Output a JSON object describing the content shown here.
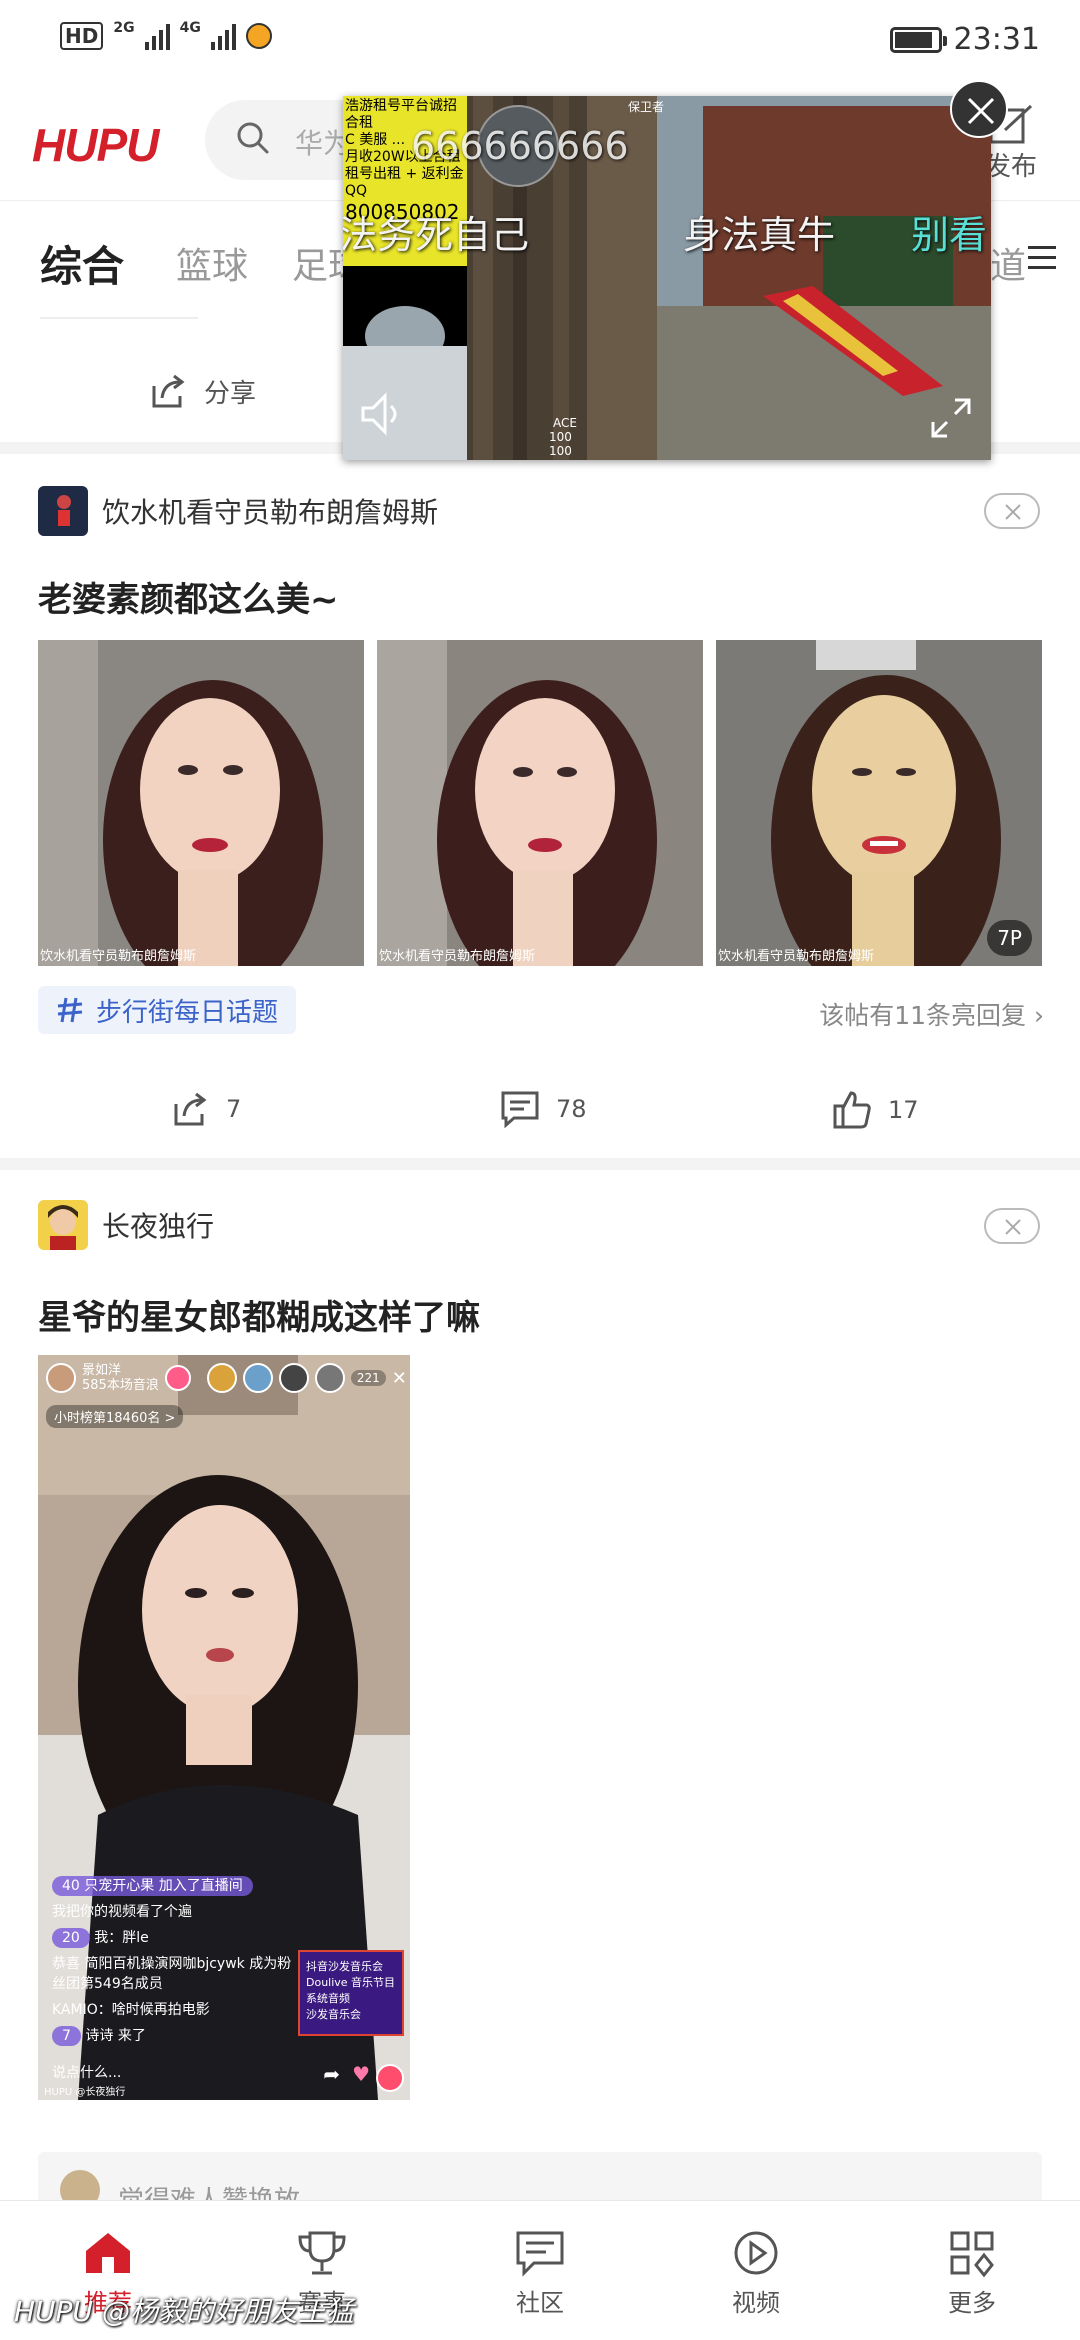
{
  "status_bar": {
    "left_badge": "HD",
    "left_badge_sub": "2",
    "net1": "2G",
    "net2": "4G",
    "time": "23:31"
  },
  "header": {
    "logo": "HUPU",
    "search_placeholder": "华为",
    "post_label": "发布"
  },
  "tabs": {
    "items": [
      "综合",
      "篮球",
      "足球"
    ],
    "right_partial": "道"
  },
  "prev_post": {
    "share_label": "分享"
  },
  "floating_video": {
    "ad_lines": [
      "浩游租号平台诚招合租",
      "C 美服 ...",
      "月收20W以上合租",
      "租号出租 + 返利金QQ",
      "800850802"
    ],
    "overlay_big": "666666666",
    "overlay_left": "法务死自己",
    "overlay_mid": "身法真牛",
    "overlay_right": "别看",
    "hud_top": "保卫者",
    "hud_hp": "100",
    "hud_ammo": "100",
    "hud_name": "ACE"
  },
  "post1": {
    "user": "饮水机看守员勒布朗詹姆斯",
    "title": "老婆素颜都这么美~",
    "photo_caption": "饮水机看守员勒布朗詹姆斯",
    "photo_count": "7P",
    "topic": "步行街每日话题",
    "reply_hint": "该帖有11条亮回复",
    "share_count": "7",
    "comment_count": "78",
    "like_count": "17"
  },
  "post2": {
    "user": "长夜独行",
    "title": "星爷的星女郎都糊成这样了嘛",
    "video": {
      "streamer": "景如洋",
      "streamer_sub": "585本场音浪",
      "viewer_count": "221",
      "rank": "小时榜第18460名 >",
      "chat": [
        {
          "lv": "40",
          "text": "只宠开心果 加入了直播间"
        },
        {
          "lv": "",
          "text": "我把你的视频看了个遍"
        },
        {
          "lv": "20",
          "text": "我：胖le"
        },
        {
          "lv": "",
          "text": "恭喜 简阳百机操演网咖bjcywk 成为粉丝团第549名成员"
        },
        {
          "lv": "",
          "text": "KAMIO：啥时候再拍电影"
        },
        {
          "lv": "7",
          "text": "诗诗 来了"
        }
      ],
      "promo": "抖音沙发音乐会 Doulive 音乐节目 系统音频",
      "promo_sub": "沙发音乐会",
      "input_placeholder": "说点什么...",
      "owner_tag": "HUPU @长夜独行"
    }
  },
  "comment_box": {
    "placeholder": "觉得难人赞换放"
  },
  "bottom_nav": {
    "items": [
      "推荐",
      "赛事",
      "社区",
      "视频",
      "更多"
    ],
    "active_index": 0
  },
  "watermark": "HUPU @杨毅的好朋友王猛",
  "colors": {
    "brand_red": "#d4202b",
    "topic_blue": "#3b63c9",
    "divider_gray": "#f3f3f3"
  }
}
